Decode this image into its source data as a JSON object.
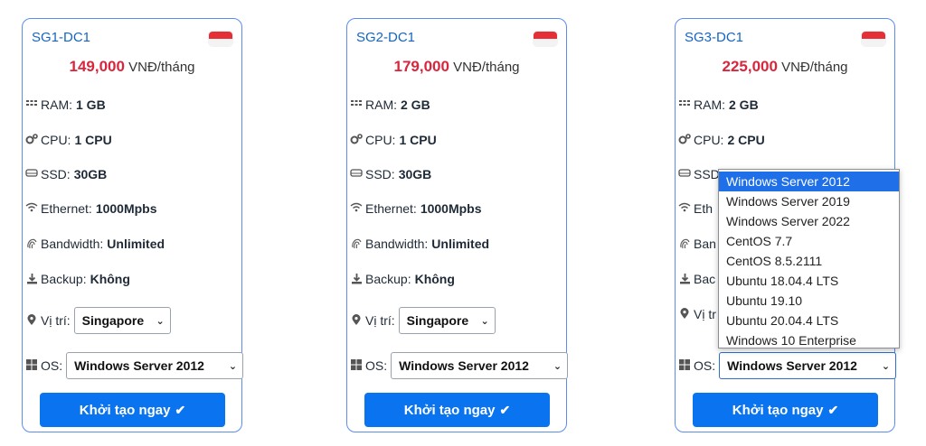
{
  "plans": [
    {
      "name": "SG1-DC1",
      "price": "149,000",
      "unit": "VNĐ/tháng",
      "ram_label": "RAM:",
      "ram": "1 GB",
      "cpu_label": "CPU:",
      "cpu": "1 CPU",
      "ssd_label": "SSD:",
      "ssd": "30GB",
      "eth_label": "Ethernet:",
      "eth": "1000Mpbs",
      "bw_label": "Bandwidth:",
      "bw": "Unlimited",
      "backup_label": "Backup:",
      "backup": "Không",
      "location_label": "Vị trí:",
      "location": "Singapore",
      "os_label": "OS:",
      "os": "Windows Server 2012",
      "button": "Khởi tạo ngay"
    },
    {
      "name": "SG2-DC1",
      "price": "179,000",
      "unit": "VNĐ/tháng",
      "ram_label": "RAM:",
      "ram": "2 GB",
      "cpu_label": "CPU:",
      "cpu": "1 CPU",
      "ssd_label": "SSD:",
      "ssd": "30GB",
      "eth_label": "Ethernet:",
      "eth": "1000Mpbs",
      "bw_label": "Bandwidth:",
      "bw": "Unlimited",
      "backup_label": "Backup:",
      "backup": "Không",
      "location_label": "Vị trí:",
      "location": "Singapore",
      "os_label": "OS:",
      "os": "Windows Server 2012",
      "button": "Khởi tạo ngay"
    },
    {
      "name": "SG3-DC1",
      "price": "225,000",
      "unit": "VNĐ/tháng",
      "ram_label": "RAM:",
      "ram": "2 GB",
      "cpu_label": "CPU:",
      "cpu": "2 CPU",
      "ssd_label": "SSD",
      "ssd": "",
      "eth_label": "Eth",
      "eth": "",
      "bw_label": "Ban",
      "bw": "",
      "backup_label": "Bac",
      "backup": "",
      "location_label": "Vị tr",
      "location": "",
      "os_label": "OS:",
      "os": "Windows Server 2012",
      "button": "Khởi tạo ngay"
    }
  ],
  "os_dropdown": {
    "options": [
      "Windows Server 2012",
      "Windows Server 2019",
      "Windows Server 2022",
      "CentOS 7.7",
      "CentOS 8.5.2111",
      "Ubuntu 18.04.4 LTS",
      "Ubuntu 19.10",
      "Ubuntu 20.04.4 LTS",
      "Windows 10 Enterprise"
    ],
    "highlighted": "Windows Server 2012"
  },
  "colors": {
    "accent": "#0a74f0",
    "price": "#d7263d",
    "title": "#1565c0",
    "card_border": "#5b8def"
  },
  "icons": {
    "ram": "memory-icon",
    "cpu": "gears-icon",
    "ssd": "hdd-icon",
    "eth": "wifi-icon",
    "bw": "fingerprint-icon",
    "backup": "download-icon",
    "location": "map-marker-icon",
    "os": "windows-icon",
    "button": "check-icon"
  }
}
